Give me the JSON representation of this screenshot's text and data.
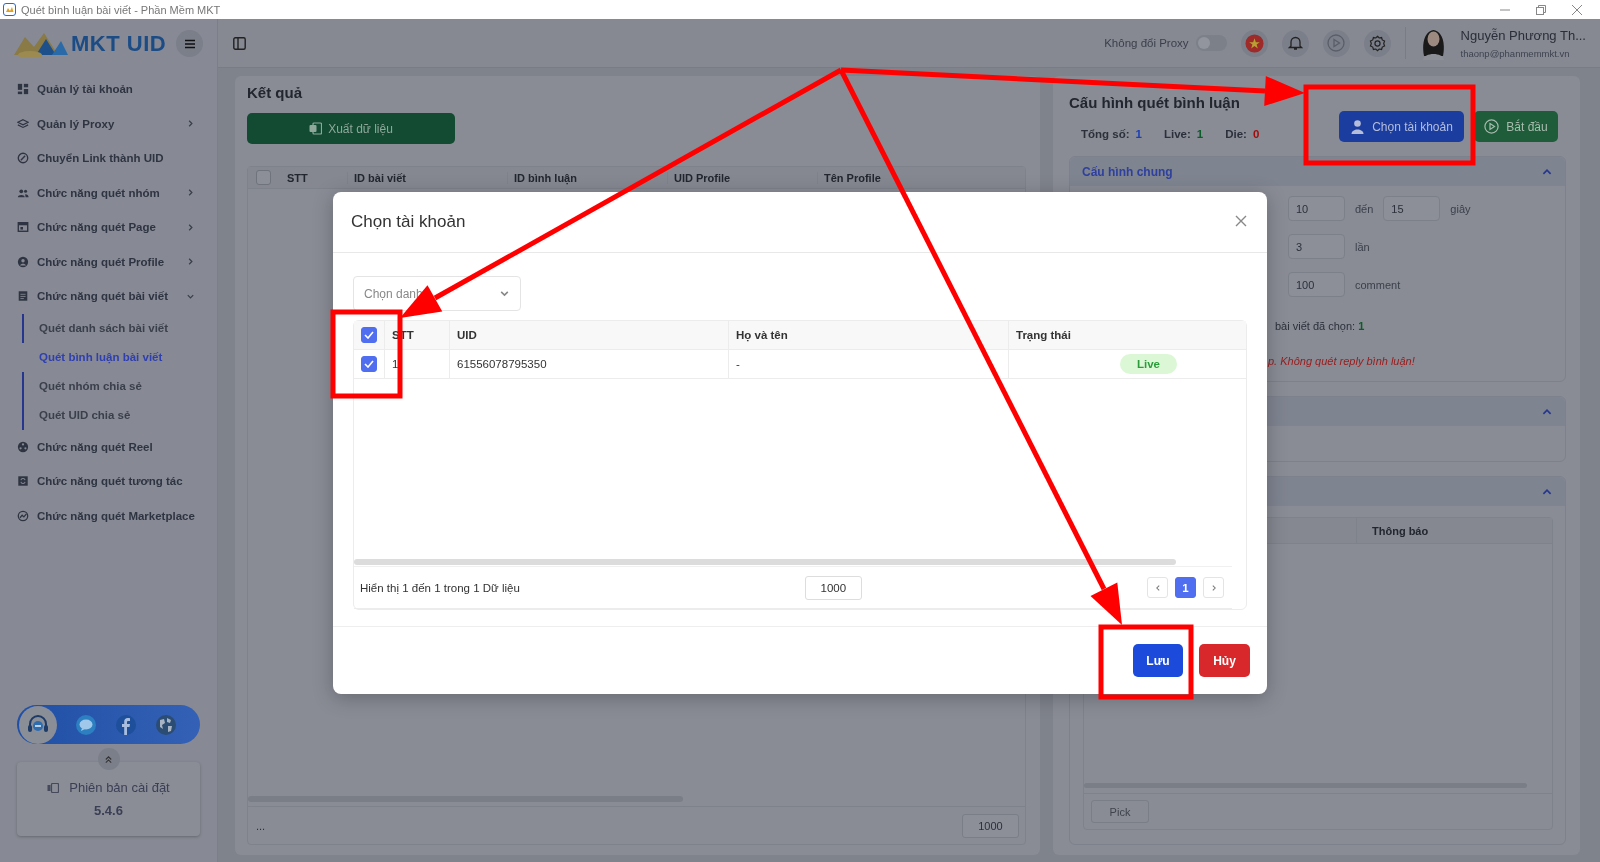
{
  "window": {
    "title": "Quét bình luận bài viết - Phần Mềm MKT"
  },
  "sidebar": {
    "logo": "MKT UID",
    "items": [
      {
        "label": "Quản lý tài khoản",
        "expandable": false
      },
      {
        "label": "Quản lý Proxy",
        "expandable": true,
        "expanded": false
      },
      {
        "label": "Chuyển Link thành UID",
        "expandable": false
      },
      {
        "label": "Chức năng quét nhóm",
        "expandable": true,
        "expanded": false
      },
      {
        "label": "Chức năng quét Page",
        "expandable": true,
        "expanded": false
      },
      {
        "label": "Chức năng quét Profile",
        "expandable": true,
        "expanded": false
      },
      {
        "label": "Chức năng quét bài viết",
        "expandable": true,
        "expanded": true,
        "children": [
          {
            "label": "Quét danh sách bài viết",
            "selected": false
          },
          {
            "label": "Quét bình luận bài viết",
            "selected": true
          },
          {
            "label": "Quét nhóm chia sẻ",
            "selected": false
          },
          {
            "label": "Quét UID chia sẻ",
            "selected": false
          }
        ]
      },
      {
        "label": "Chức năng quét Reel",
        "expandable": false
      },
      {
        "label": "Chức năng quét tương tác",
        "expandable": false
      },
      {
        "label": "Chức năng quét Marketplace",
        "expandable": false
      }
    ],
    "version": {
      "label": "Phiên bản cài đặt",
      "number": "5.4.6"
    }
  },
  "header": {
    "proxy_toggle": {
      "label": "Không đổi Proxy",
      "on": false
    },
    "user": {
      "name": "Nguyễn Phương Th...",
      "email": "thaonp@phanmemmkt.vn"
    }
  },
  "results": {
    "title": "Kết quả",
    "export_button": "Xuất dữ liệu",
    "table": {
      "select_all": false,
      "columns": [
        "STT",
        "ID bài viết",
        "ID bình luận",
        "UID Profile",
        "Tên Profile"
      ]
    },
    "footer": {
      "info": "...",
      "page_size": "1000"
    }
  },
  "config": {
    "title": "Cấu hình quét bình luận",
    "stats": [
      {
        "label": "Tổng số:",
        "value": "1",
        "color": "#1c3fb8"
      },
      {
        "label": "Live:",
        "value": "1",
        "color": "#0a5c28"
      },
      {
        "label": "Die:",
        "value": "0",
        "color": "#a00d0d"
      }
    ],
    "choose_account_button": "Chọn tài khoản",
    "start_button": "Bắt đầu",
    "sections": [
      {
        "title": "Cấu hình chung",
        "expanded": true
      },
      {
        "expanded": true
      },
      {
        "expanded": true
      }
    ],
    "rows": [
      {
        "kind": "range",
        "from": "10",
        "joiner": "đến",
        "to": "15",
        "unit": "giây"
      },
      {
        "kind": "number",
        "value": "3",
        "unit": "lần"
      },
      {
        "kind": "number",
        "value": "100",
        "unit": "comment"
      }
    ],
    "selected_posts": {
      "label": "bài viết đã chọn: ",
      "count": "1"
    },
    "note": "p. Không quét reply bình luận!",
    "log_table": {
      "columns": [
        "Thông báo"
      ]
    },
    "pick_button": "Pick"
  },
  "modal": {
    "title": "Chọn tài khoản",
    "category_placeholder": "Chọn danh",
    "table": {
      "select_all": true,
      "columns": [
        "STT",
        "UID",
        "Họ và tên",
        "Trạng thái"
      ],
      "rows": [
        {
          "checked": true,
          "stt": "1",
          "uid": "61556078795350",
          "name": "-",
          "status": "Live"
        }
      ]
    },
    "info": "Hiển thị 1 đến 1 trong 1 Dữ liệu",
    "page_size": "1000",
    "pages": [
      {
        "label": "1",
        "selected": true
      }
    ],
    "save_button": "Lưu",
    "cancel_button": "Hủy"
  }
}
